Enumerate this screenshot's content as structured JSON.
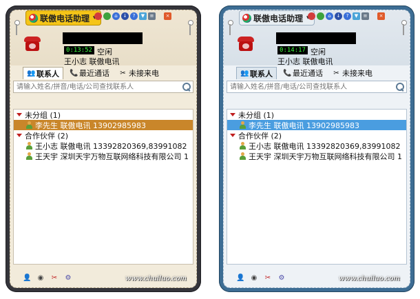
{
  "windows": [
    {
      "theme": "dark",
      "title": "联傲电话助理",
      "call_timer": "0:13:52",
      "status": "空闲",
      "user_line": "王小志  联傲电讯",
      "tabs": [
        {
          "label": "联系人",
          "icon": "contacts-icon",
          "active": true
        },
        {
          "label": "最近通话",
          "icon": "recent-calls-icon",
          "active": false
        },
        {
          "label": "未接来电",
          "icon": "missed-call-icon",
          "active": false
        }
      ],
      "search_placeholder": "请输入姓名/拼音/电话/公司查找联系人",
      "groups": [
        {
          "label": "未分组 (1)",
          "contacts": [
            {
              "text": "李先生  联傲电讯  13902985983",
              "selected": true
            }
          ]
        },
        {
          "label": "合作伙伴 (2)",
          "contacts": [
            {
              "text": "王小志  联傲电讯  13392820369,83991082",
              "selected": false
            },
            {
              "text": "王天宇  深圳天宇万物互联网络科技有限公司  1",
              "selected": false
            }
          ]
        }
      ],
      "watermark": "www.chuiluo.com"
    },
    {
      "theme": "blue",
      "title": "联傲电话助理",
      "call_timer": "0:14:17",
      "status": "空闲",
      "user_line": "王小志  联傲电讯",
      "tabs": [
        {
          "label": "联系人",
          "icon": "contacts-icon",
          "active": true
        },
        {
          "label": "最近通话",
          "icon": "recent-calls-icon",
          "active": false
        },
        {
          "label": "未接来电",
          "icon": "missed-call-icon",
          "active": false
        }
      ],
      "search_placeholder": "请输入姓名/拼音/电话/公司查找联系人",
      "groups": [
        {
          "label": "未分组 (1)",
          "contacts": [
            {
              "text": "李先生  联傲电讯  13902985983",
              "selected": true
            }
          ]
        },
        {
          "label": "合作伙伴 (2)",
          "contacts": [
            {
              "text": "王小志  联傲电讯  13392820369,83991082",
              "selected": false
            },
            {
              "text": "王天宇  深圳天宇万物互联网络科技有限公司  1",
              "selected": false
            }
          ]
        }
      ],
      "watermark": "www.chuiluo.com"
    }
  ],
  "colors": {
    "dark_frame": "#35353b",
    "blue_frame": "#3d6d94",
    "dark_selection": "#c9862a",
    "blue_selection": "#4a9de0",
    "timer_text": "#3dff3d",
    "group_arrow": "#c02020"
  }
}
